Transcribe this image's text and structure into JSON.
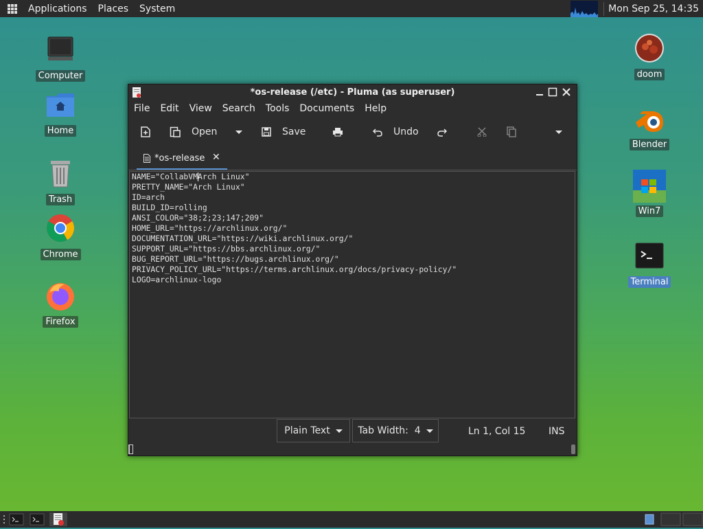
{
  "top_panel": {
    "menu_applications": "Applications",
    "menu_places": "Places",
    "menu_system": "System",
    "clock": "Mon Sep 25, 14:35"
  },
  "desktop": {
    "icons_left": [
      {
        "label": "Computer",
        "icon": "computer-icon"
      },
      {
        "label": "Home",
        "icon": "home-folder-icon"
      },
      {
        "label": "Trash",
        "icon": "trash-icon"
      },
      {
        "label": "Chrome",
        "icon": "chrome-icon"
      },
      {
        "label": "Firefox",
        "icon": "firefox-icon"
      }
    ],
    "icons_right": [
      {
        "label": "doom",
        "icon": "doom-icon"
      },
      {
        "label": "Blender",
        "icon": "blender-icon"
      },
      {
        "label": "Win7",
        "icon": "win7-icon"
      },
      {
        "label": "Terminal",
        "icon": "terminal-icon"
      }
    ]
  },
  "window": {
    "title": "*os-release (/etc) - Pluma (as superuser)",
    "menus": [
      "File",
      "Edit",
      "View",
      "Search",
      "Tools",
      "Documents",
      "Help"
    ],
    "toolbar": {
      "open_label": "Open",
      "save_label": "Save",
      "undo_label": "Undo"
    },
    "tab": {
      "label": "*os-release",
      "close": "✕"
    },
    "editor_lines": [
      "NAME=\"CollabVM|Arch Linux\"",
      "PRETTY_NAME=\"Arch Linux\"",
      "ID=arch",
      "BUILD_ID=rolling",
      "ANSI_COLOR=\"38;2;23;147;209\"",
      "HOME_URL=\"https://archlinux.org/\"",
      "DOCUMENTATION_URL=\"https://wiki.archlinux.org/\"",
      "SUPPORT_URL=\"https://bbs.archlinux.org/\"",
      "BUG_REPORT_URL=\"https://bugs.archlinux.org/\"",
      "PRIVACY_POLICY_URL=\"https://terms.archlinux.org/docs/privacy-policy/\"",
      "LOGO=archlinux-logo"
    ],
    "statusbar": {
      "syntax": "Plain Text",
      "tab_width": "Tab Width:  4",
      "position": "Ln 1, Col 15",
      "mode": "INS"
    }
  },
  "colors": {
    "accent": "#5a8fd0",
    "panel": "#2b2b2b",
    "window_bg": "#2d2d2d"
  }
}
